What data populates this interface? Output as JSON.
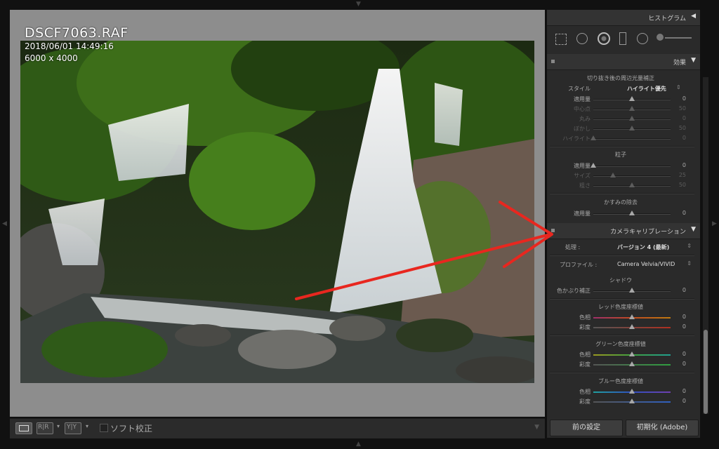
{
  "photo": {
    "filename": "DSCF7063.RAF",
    "datetime": "2018/06/01 14:49:16",
    "dimensions": "6000 x 4000"
  },
  "toolbar": {
    "view_loupe": "",
    "view_before_after": "R|R",
    "view_ref": "Y|Y",
    "soft_proof_label": "ソフト校正"
  },
  "panels": {
    "histogram": {
      "title": "ヒストグラム"
    },
    "effects": {
      "title": "効果",
      "vignette_title": "切り抜き後の周辺光量補正",
      "style_label": "スタイル",
      "style_value": "ハイライト優先",
      "vignette_rows": [
        {
          "label": "適用量",
          "value": "0"
        },
        {
          "label": "中心点",
          "value": "50"
        },
        {
          "label": "丸み",
          "value": "0"
        },
        {
          "label": "ぼかし",
          "value": "50"
        },
        {
          "label": "ハイライト",
          "value": "0"
        }
      ],
      "grain_title": "粒子",
      "grain_rows": [
        {
          "label": "適用量",
          "value": "0"
        },
        {
          "label": "サイズ",
          "value": "25"
        },
        {
          "label": "粗さ",
          "value": "50"
        }
      ],
      "dehaze_title": "かすみの除去",
      "dehaze_rows": [
        {
          "label": "適用量",
          "value": "0"
        }
      ]
    },
    "calibration": {
      "title": "カメラキャリブレーション",
      "process_label": "処理 :",
      "process_value": "バージョン 4 (最新)",
      "profile_label": "プロファイル :",
      "profile_value": "Camera Velvia/VIVID",
      "shadows_title": "シャドウ",
      "shadows_rows": [
        {
          "label": "色かぶり補正",
          "value": "0"
        }
      ],
      "red_title": "レッド色度座標値",
      "red_rows": [
        {
          "label": "色相",
          "value": "0"
        },
        {
          "label": "彩度",
          "value": "0"
        }
      ],
      "green_title": "グリーン色度座標値",
      "green_rows": [
        {
          "label": "色相",
          "value": "0"
        },
        {
          "label": "彩度",
          "value": "0"
        }
      ],
      "blue_title": "ブルー色度座標値",
      "blue_rows": [
        {
          "label": "色相",
          "value": "0"
        },
        {
          "label": "彩度",
          "value": "0"
        }
      ]
    }
  },
  "buttons": {
    "previous": "前の設定",
    "reset": "初期化 (Adobe)"
  },
  "colors": {
    "annotation_arrow": "#e8271f",
    "panel_bg": "#2a2a2a",
    "view_bg": "#8d8d8d"
  }
}
